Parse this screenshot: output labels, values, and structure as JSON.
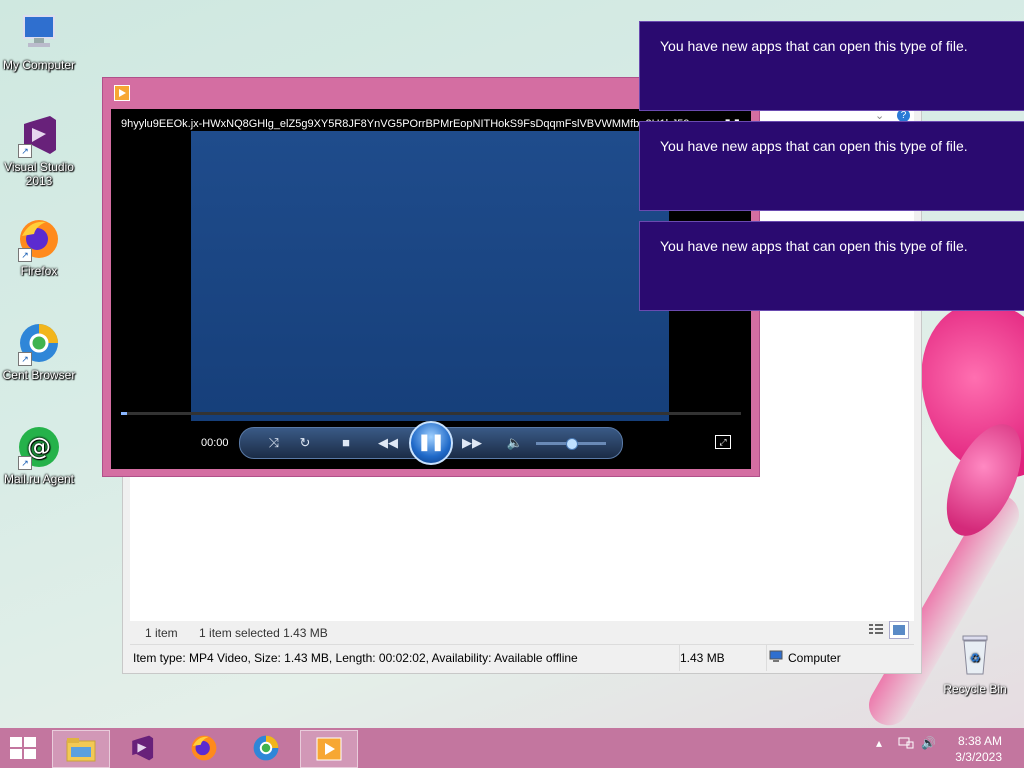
{
  "desktop": {
    "icons": [
      {
        "label": "My Computer"
      },
      {
        "label": "Visual Studio 2013"
      },
      {
        "label": "Firefox"
      },
      {
        "label": "Cent Browser"
      },
      {
        "label": "Mail.ru Agent"
      }
    ],
    "recycle_bin": "Recycle Bin"
  },
  "player": {
    "title": "9hyylu9EEOk.jx-HWxNQ8GHlg_elZ5g9XY5R8JF8YnVG5POrrBPMrEopNITHokS9FsDqqmFslVBVWMMfb_2H1hJ59",
    "time": "00:00",
    "state": "playing",
    "progress": 0.01,
    "volume": 0.5
  },
  "explorer": {
    "item_count": "1 item",
    "selected": "1 item selected  1.43 MB",
    "details": "Item type: MP4 Video, Size: 1.43 MB, Length: 00:02:02, Availability: Available offline",
    "size": "1.43 MB",
    "location": "Computer"
  },
  "notifications": [
    {
      "text": "You have new apps that can open this type of file."
    },
    {
      "text": "You have new apps that can open this type of file."
    },
    {
      "text": "You have new apps that can open this type of file."
    }
  ],
  "taskbar": {
    "time": "8:38 AM",
    "date": "3/3/2023",
    "apps": [
      "file-explorer",
      "visual-studio",
      "firefox",
      "cent-browser",
      "windows-media-player"
    ]
  },
  "colors": {
    "notification_bg": "#2a0a70",
    "taskbar_bg": "#c3769f",
    "player_frame": "#d46ea2"
  }
}
